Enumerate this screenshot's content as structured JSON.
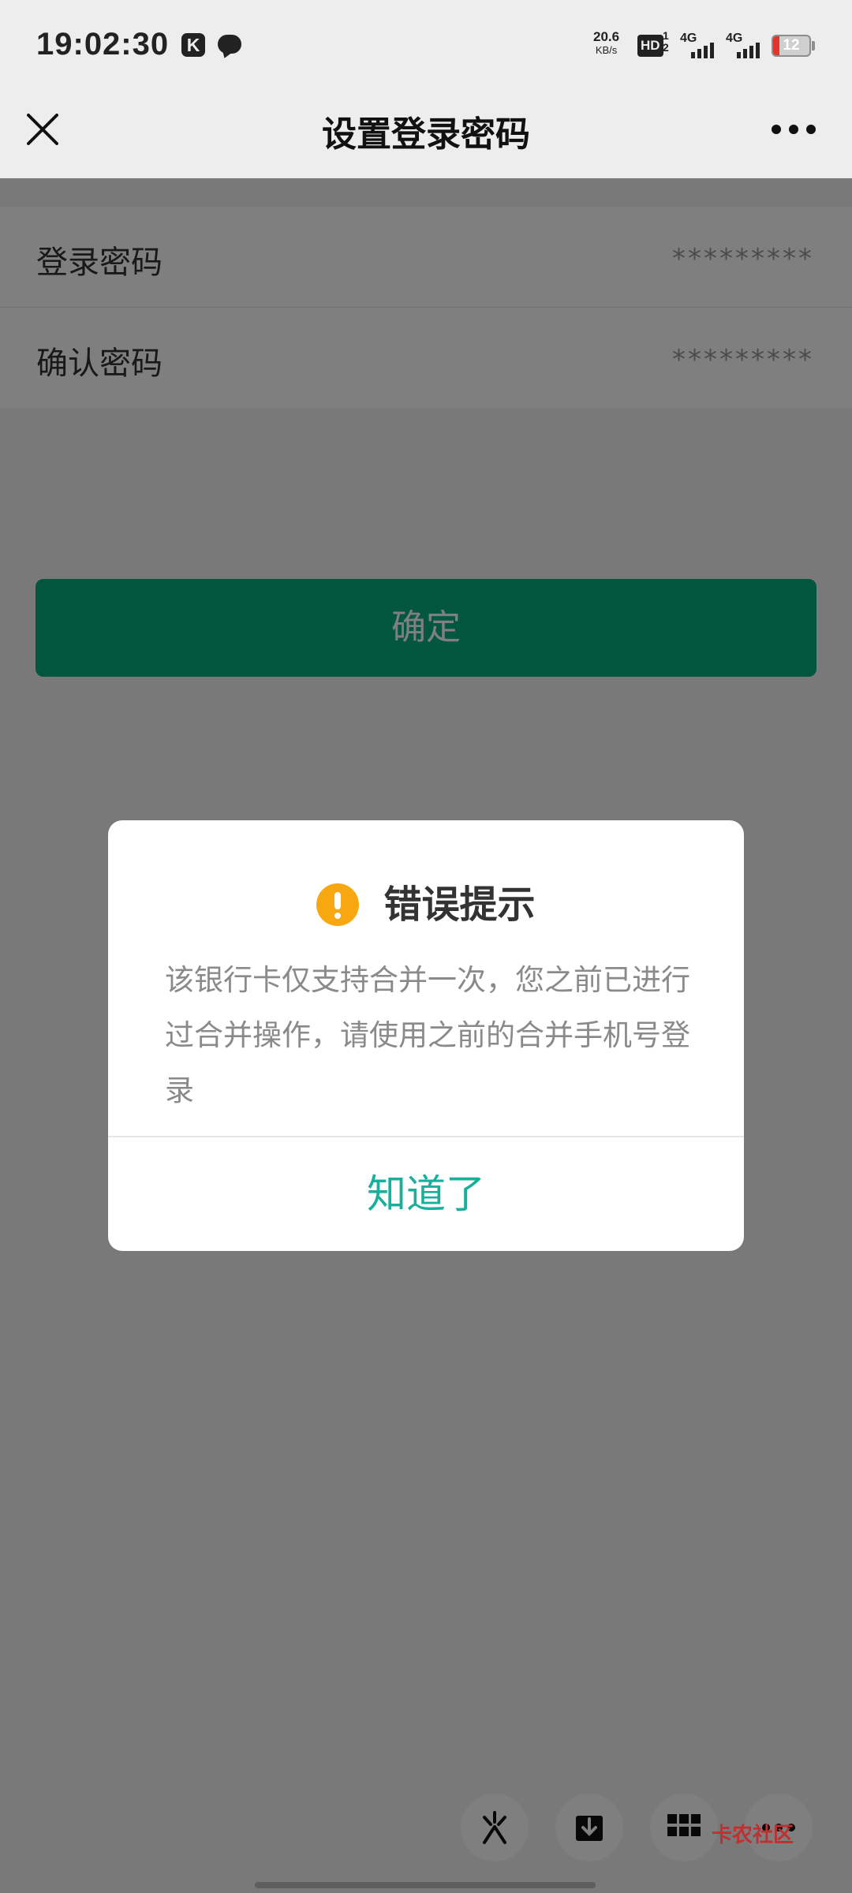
{
  "status_bar": {
    "time": "19:02:30",
    "k_badge": "K",
    "net_speed_value": "20.6",
    "net_speed_unit": "KB/s",
    "hd_label": "HD",
    "hd_sim_top": "1",
    "hd_sim_bottom": "2",
    "sim1_type": "4G",
    "sim2_type": "4G",
    "battery_level": "12"
  },
  "nav": {
    "title": "设置登录密码"
  },
  "form": {
    "rows": [
      {
        "label": "登录密码",
        "value": "*********"
      },
      {
        "label": "确认密码",
        "value": "*********"
      }
    ],
    "confirm_label": "确定"
  },
  "dialog": {
    "title": "错误提示",
    "message": "该银行卡仅支持合并一次，您之前已进行过合并操作，请使用之前的合并手机号登录",
    "ok_label": "知道了"
  },
  "watermark": "卡农社区",
  "colors": {
    "primary_green": "#06ae7e",
    "dialog_button_text": "#17b09c",
    "warning_icon": "#f7a70f",
    "battery_low": "#e0352b"
  }
}
